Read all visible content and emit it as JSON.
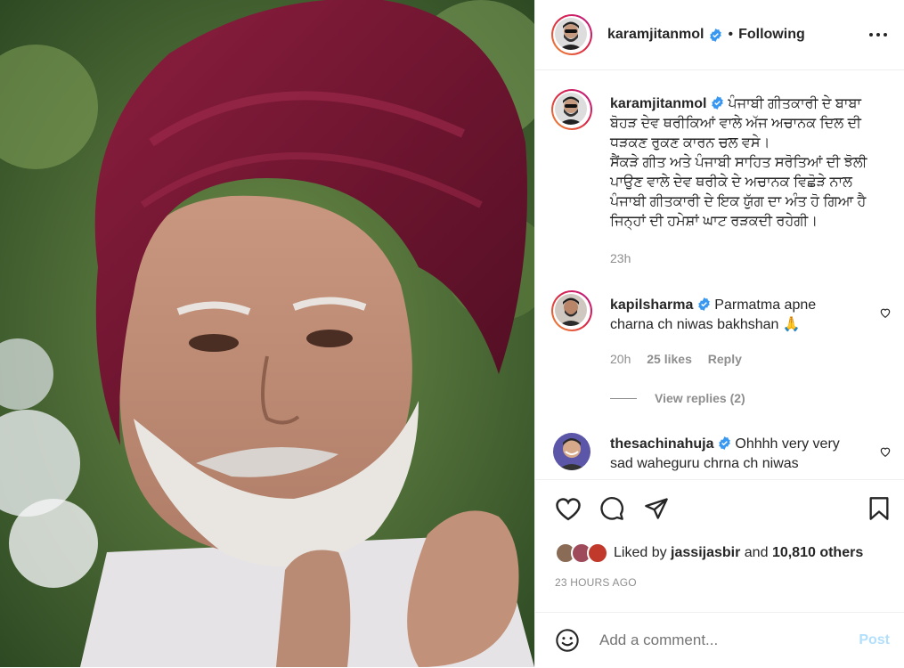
{
  "author": {
    "username": "karamjitanmol",
    "follow_status": "Following"
  },
  "caption": {
    "username": "karamjitanmol",
    "lines": [
      "ਪੰਜਾਬੀ ਗੀਤਕਾਰੀ ਦੇ ਬਾਬਾ",
      "ਬੋਹੜ ਦੇਵ ਥਰੀਕਿਆਂ ਵਾਲੇ ਅੱਜ ਅਚਾਨਕ ਦਿਲ ਦੀ",
      "ਧੜਕਣ ਰੁਕਣ ਕਾਰਨ ਚਲ ਵਸੇ।",
      "ਸੈਂਕੜੇ ਗੀਤ ਅਤੇ ਪੰਜਾਬੀ ਸਾਹਿਤ ਸਰੋਤਿਆਂ ਦੀ ਝੋਲੀ",
      "ਪਾਉਣ ਵਾਲੇ ਦੇਵ ਥਰੀਕੇ ਦੇ ਅਚਾਨਕ ਵਿਛੋੜੇ ਨਾਲ",
      "ਪੰਜਾਬੀ ਗੀਤਕਾਰੀ ਦੇ ਇਕ ਯੁੱਗ ਦਾ ਅੰਤ ਹੋ ਗਿਆ ਹੈ",
      "ਜਿਨ੍ਹਾਂ ਦੀ ਹਮੇਸ਼ਾਂ ਘਾਟ ਰੜਕਦੀ ਰਹੇਗੀ।"
    ],
    "time": "23h"
  },
  "comments": [
    {
      "username": "kapilsharma",
      "line1": "Parmatma apne",
      "line2": "charna ch niwas bakhshan 🙏",
      "time": "20h",
      "likes": "25 likes",
      "reply": "Reply",
      "view_replies": "View replies (2)"
    },
    {
      "username": "thesachinahuja",
      "line1": "Ohhhh very very",
      "line2": "sad waheguru chrna ch niwas"
    }
  ],
  "likes": {
    "prefix": "Liked by",
    "user": "jassijasbir",
    "and": "and",
    "others": "10,810 others"
  },
  "posted": "23 HOURS AGO",
  "add_comment": {
    "placeholder": "Add a comment...",
    "post_label": "Post"
  },
  "colors": {
    "verified": "#3897f0",
    "link_muted": "#b2dffc",
    "secondary": "#8e8e8e"
  }
}
